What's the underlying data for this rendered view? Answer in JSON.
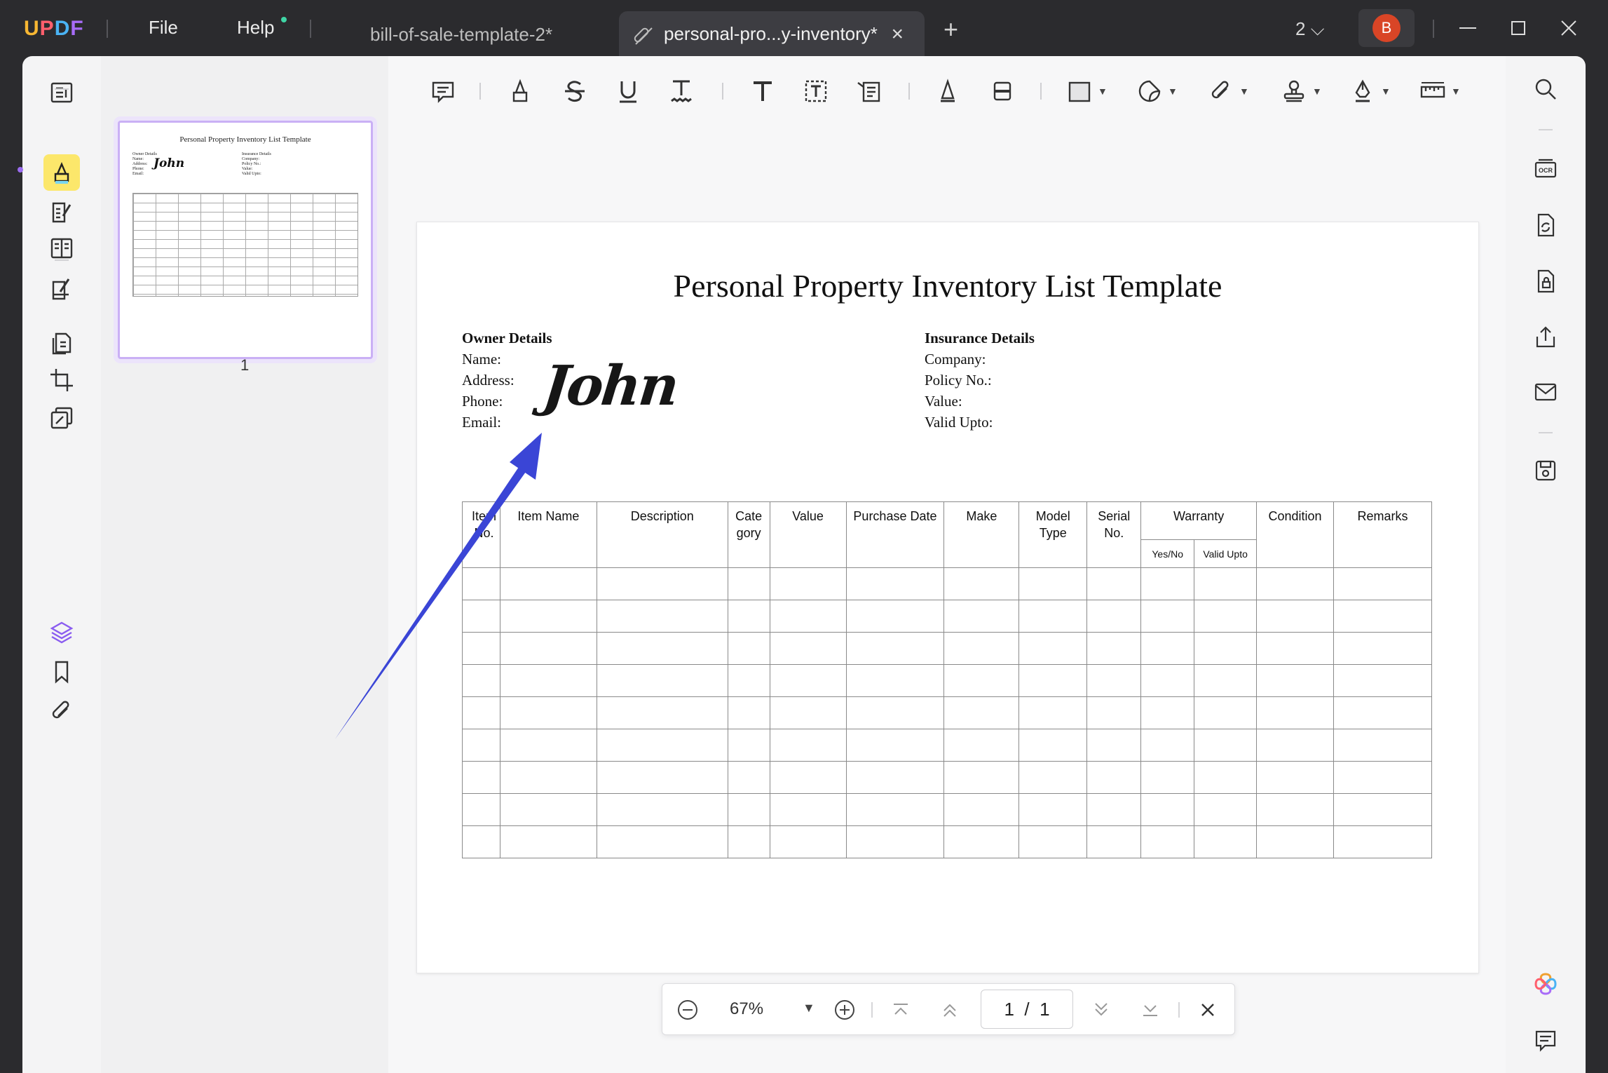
{
  "app": {
    "logo": "UPDF"
  },
  "menu": {
    "file": "File",
    "help": "Help"
  },
  "tabs": [
    {
      "label": "bill-of-sale-template-2*"
    },
    {
      "label": "personal-pro...y-inventory*"
    }
  ],
  "window": {
    "count": "2",
    "avatar_initial": "B"
  },
  "thumbnail": {
    "title": "Personal Property Inventory List Template",
    "page_label": "1",
    "owner_lines": "Owner Details\nName:\nAddress:\nPhone:\nEmail:",
    "insurance_lines": "Insurance Details\nCompany:\nPolicy No.:\nValue:\nValid Upto:",
    "signature": "John"
  },
  "document": {
    "title": "Personal Property Inventory List Template",
    "owner": {
      "heading": "Owner Details",
      "fields": [
        "Name:",
        "Address:",
        "Phone:",
        "Email:"
      ]
    },
    "insurance": {
      "heading": "Insurance Details",
      "fields": [
        "Company:",
        "Policy No.:",
        "Value:",
        "Valid Upto:"
      ]
    },
    "signature": "John",
    "table": {
      "headers": [
        "Item No.",
        "Item Name",
        "Description",
        "Cate gory",
        "Value",
        "Purchase Date",
        "Make",
        "Model Type",
        "Serial No.",
        "Warranty",
        "Condition",
        "Remarks"
      ],
      "warranty_sub": [
        "Yes/No",
        "Valid Upto"
      ],
      "empty_rows": 9
    }
  },
  "zoom": {
    "value": "67%",
    "current_page": "1",
    "separator": "/",
    "total_pages": "1"
  },
  "colors": {
    "accent_purple": "#9b6cf0",
    "highlight_yellow": "#fce76b",
    "arrow_blue": "#3a45d6",
    "avatar_red": "#d94526"
  }
}
